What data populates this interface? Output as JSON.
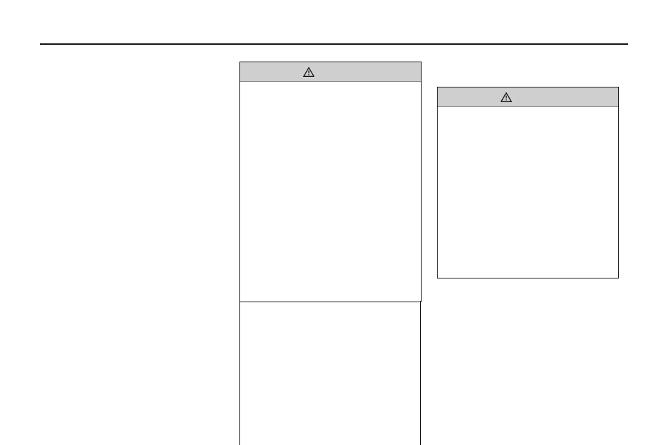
{
  "header": {
    "section_title": ""
  },
  "center_box": {
    "label": "CAUTION",
    "body_lines": [
      "",
      "",
      "",
      "",
      "",
      "",
      "",
      "",
      "",
      "",
      "",
      "",
      "",
      "",
      "",
      "",
      "",
      "",
      "",
      "",
      "",
      ""
    ]
  },
  "right_box": {
    "label": "CAUTION",
    "body_lines": [
      "",
      "",
      "",
      "",
      "",
      "",
      "",
      "",
      "",
      "",
      "",
      "",
      "",
      "",
      "",
      ""
    ]
  }
}
